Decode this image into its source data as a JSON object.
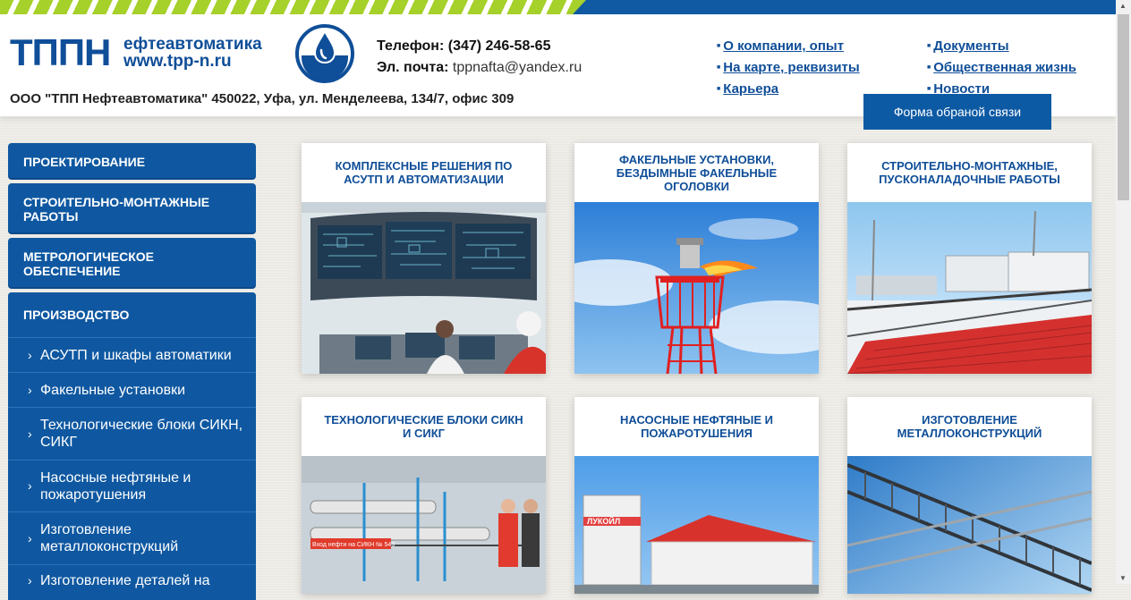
{
  "header": {
    "logo_big": "ТППН",
    "logo_line1": "ефтеавтоматика",
    "logo_line2": "www.tpp-n.ru",
    "address": "ООО \"ТПП Нефтеавтоматика\" 450022, Уфа, ул. Менделеева, 134/7, офис 309",
    "phone_label": "Телефон:",
    "phone_value": "(347) 246-58-65",
    "email_label": "Эл. почта:",
    "email_value": "tppnafta@yandex.ru",
    "nav_col1": [
      "О компании, опыт",
      "На карте, реквизиты",
      "Карьера"
    ],
    "nav_col2": [
      "Документы",
      "Общественная жизнь",
      "Новости"
    ],
    "feedback_button": "Форма обраной связи"
  },
  "sidebar": {
    "main_items": [
      "ПРОЕКТИРОВАНИЕ",
      "СТРОИТЕЛЬНО-МОНТАЖНЫЕ РАБОТЫ",
      "МЕТРОЛОГИЧЕСКОЕ ОБЕСПЕЧЕНИЕ",
      "ПРОИЗВОДСТВО"
    ],
    "sub_items": [
      "АСУТП и шкафы автоматики",
      "Факельные установки",
      "Технологические блоки СИКН, СИКГ",
      "Насосные нефтяные и пожаротушения",
      "Изготовление металлоконструкций",
      "Изготовление деталей на"
    ],
    "chevron": "›"
  },
  "cards": [
    {
      "title": "КОМПЛЕКСНЫЕ РЕШЕНИЯ ПО АСУТП И АВТОМАТИЗАЦИИ"
    },
    {
      "title": "ФАКЕЛЬНЫЕ УСТАНОВКИ, БЕЗДЫМНЫЕ ФАКЕЛЬНЫЕ ОГОЛОВКИ"
    },
    {
      "title": "СТРОИТЕЛЬНО-МОНТАЖНЫЕ, ПУСКОНАЛАДОЧНЫЕ РАБОТЫ"
    },
    {
      "title": "ТЕХНОЛОГИЧЕСКИЕ БЛОКИ СИКН И СИКГ"
    },
    {
      "title": "НАСОСНЫЕ НЕФТЯНЫЕ И ПОЖАРОТУШЕНИЯ"
    },
    {
      "title": "ИЗГОТОВЛЕНИЕ МЕТАЛЛОКОНСТРУКЦИЙ"
    }
  ],
  "photo_text": {
    "lukoil": "ЛУКОЙЛ",
    "sikn_sign": "Вход нефти на СИКН № 543"
  },
  "colors": {
    "brand_blue": "#0f58a1",
    "accent_green": "#a6d02a"
  }
}
